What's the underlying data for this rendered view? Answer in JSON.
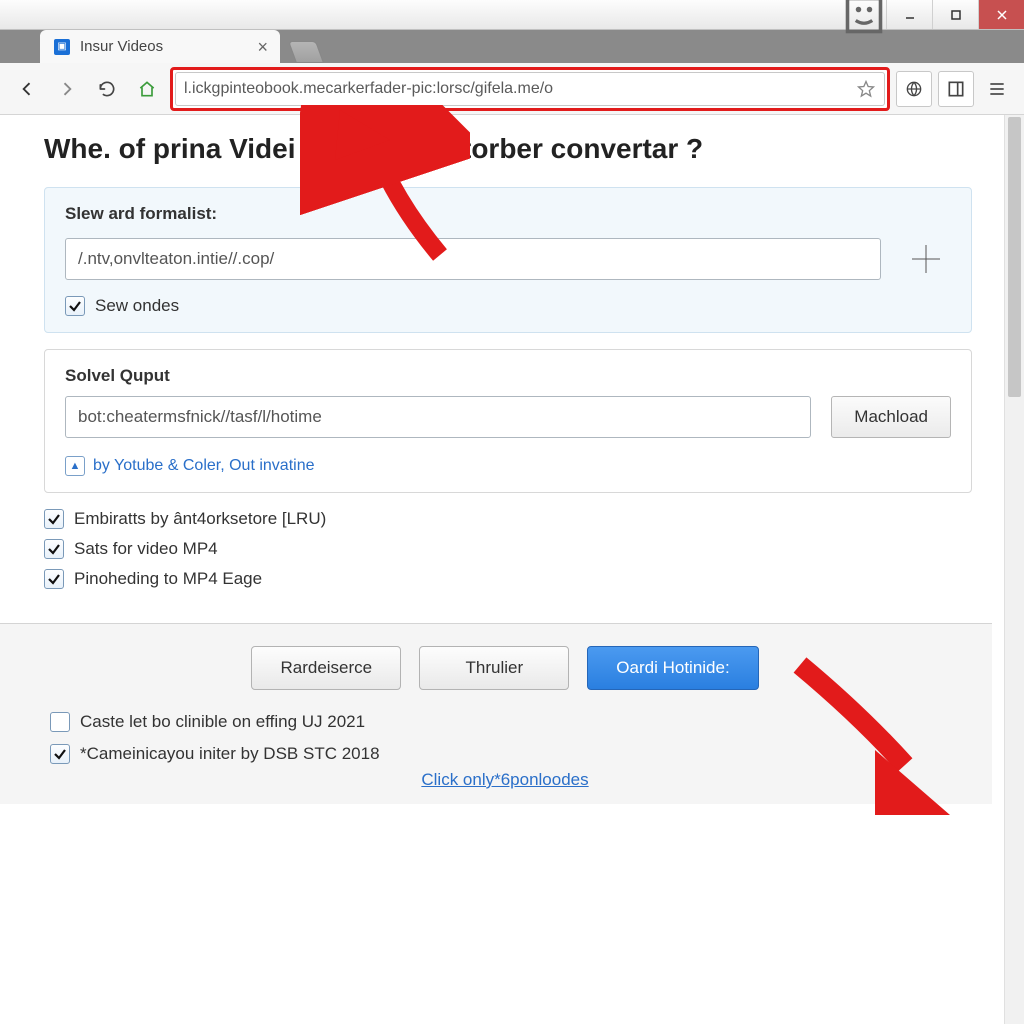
{
  "tab": {
    "title": "Insur Videos"
  },
  "addressbar": {
    "url": "l.ickgpinteobook.mecarkerfader-pic:lorsc/gifela.me/o"
  },
  "page": {
    "heading": "Whe. of prina Videi i   4. Squiner torber convertar ?"
  },
  "panel1": {
    "label": "Slew ard formalist:",
    "input_value": "/.ntv,onvlteaton.intie//.cop/",
    "checkbox_label": "Sew ondes"
  },
  "panel2": {
    "label": "Solvel Quput",
    "input_value": "bot:cheatermsfnick//tasf/l/hotime",
    "button_label": "Machload"
  },
  "info_line": "by Yotube & Coler, Out invatine",
  "checks": {
    "c1": "Embiratts by ânt4orksetore [LRU)",
    "c2": "Sats for video MP4",
    "c3": "Pinoheding to MP4 Eage"
  },
  "footer": {
    "btn1": "Rardeiserce",
    "btn2": "Thrulier",
    "btn3": "Oardi Hotinide:",
    "chk1": "Caste let bo clinible on effing UJ 2021",
    "chk2": "*Cameinicayou initer by DSB STC 2018",
    "link": "Click only*6ponloodes"
  }
}
